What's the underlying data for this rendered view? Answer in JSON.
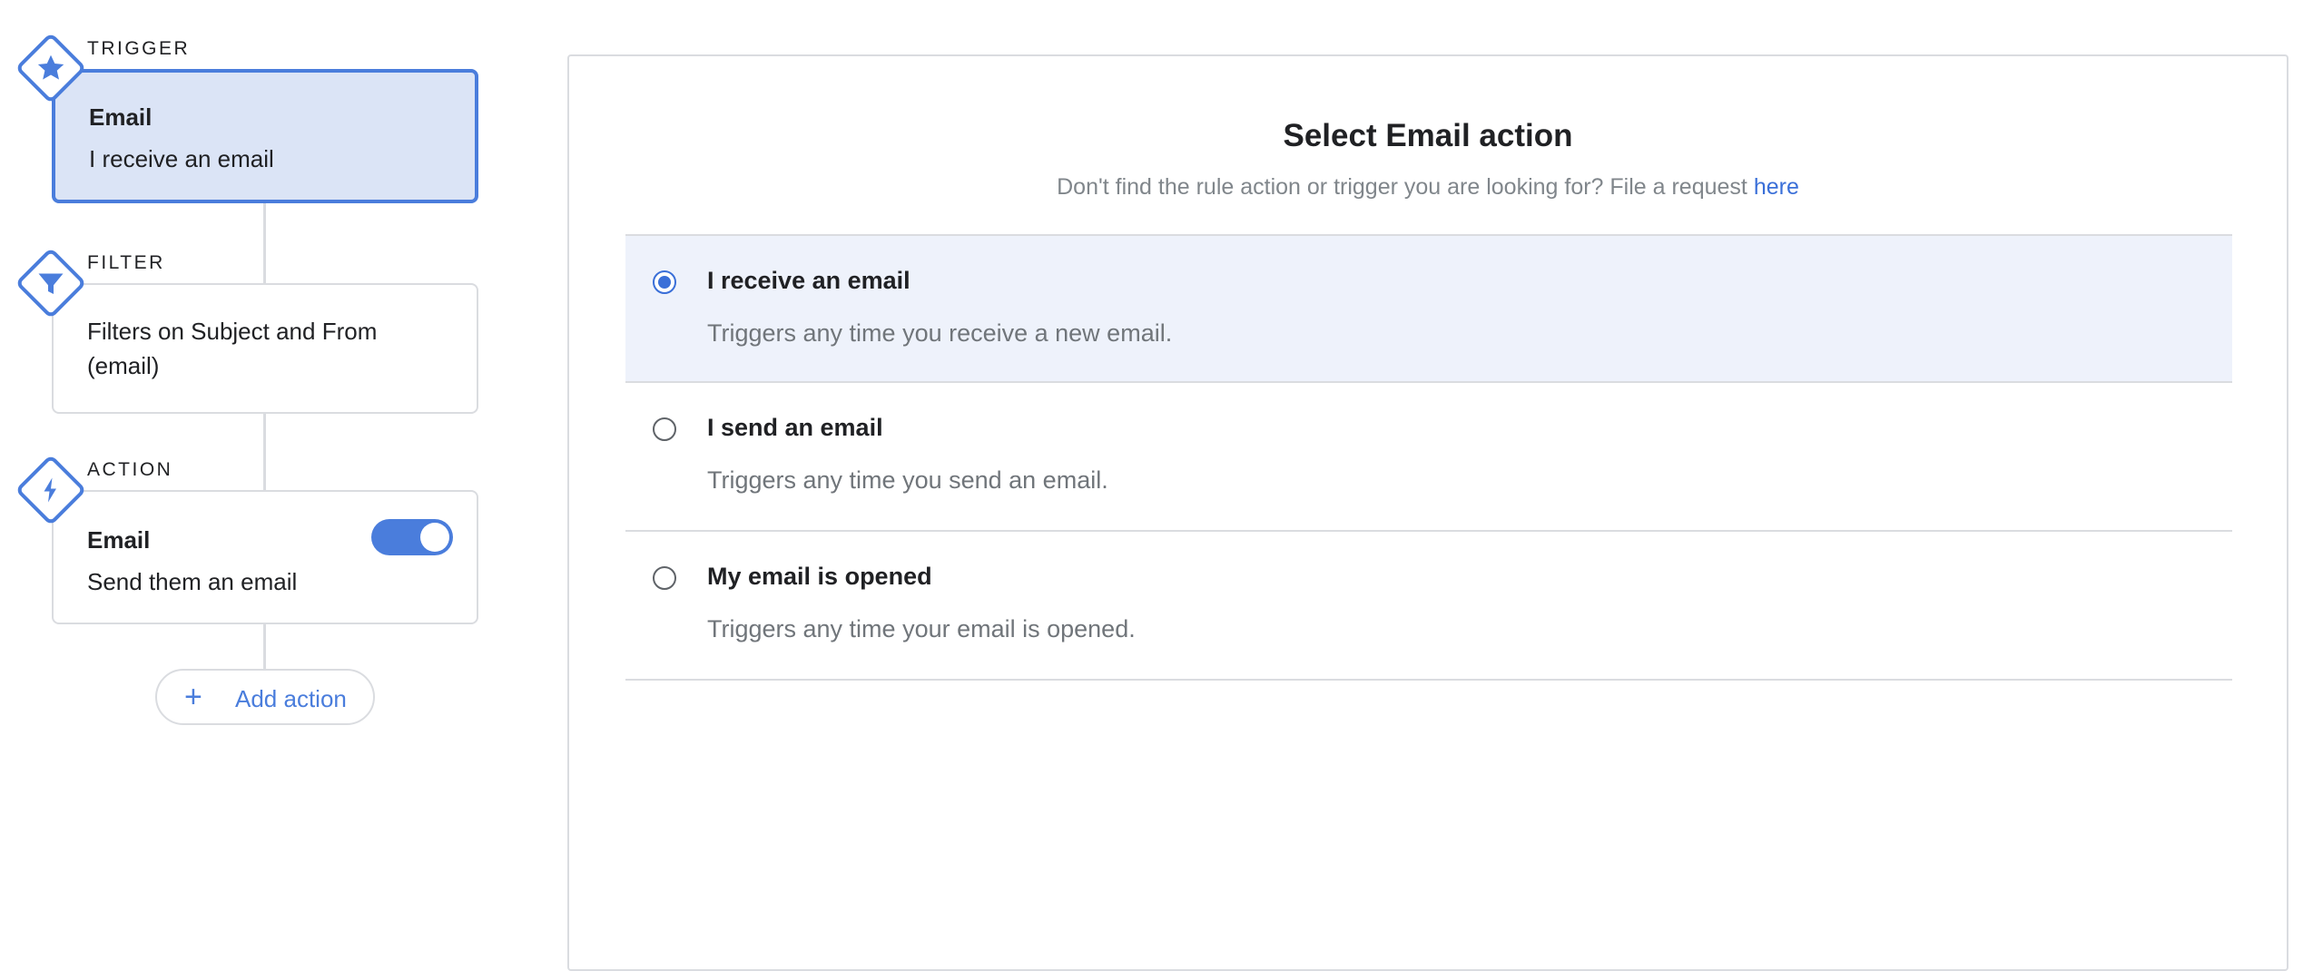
{
  "flow": {
    "trigger": {
      "section_label": "TRIGGER",
      "icon": "star-icon",
      "title": "Email",
      "subtitle": "I receive an email"
    },
    "filter": {
      "section_label": "FILTER",
      "icon": "filter-funnel-icon",
      "text": "Filters on Subject and From (email)"
    },
    "action": {
      "section_label": "ACTION",
      "icon": "lightning-bolt-icon",
      "title": "Email",
      "subtitle": "Send them an email",
      "enabled": true
    },
    "add_action": {
      "icon": "plus-icon",
      "label": "Add action"
    }
  },
  "panel": {
    "title": "Select Email action",
    "subtitle_prefix": "Don't find the rule action or trigger you are looking for? File a request ",
    "subtitle_link": "here",
    "options": [
      {
        "title": "I receive an email",
        "description": "Triggers any time you receive a new email.",
        "selected": true
      },
      {
        "title": "I send an email",
        "description": "Triggers any time you send an email.",
        "selected": false
      },
      {
        "title": "My email is opened",
        "description": "Triggers any time your email is opened.",
        "selected": false
      }
    ]
  },
  "colors": {
    "accent": "#4a7ddc",
    "link": "#3a6fd8",
    "selected_card_bg": "#dbe4f6",
    "selected_option_bg": "#eef2fb",
    "border": "#dadce0",
    "muted_text": "#70757a"
  }
}
